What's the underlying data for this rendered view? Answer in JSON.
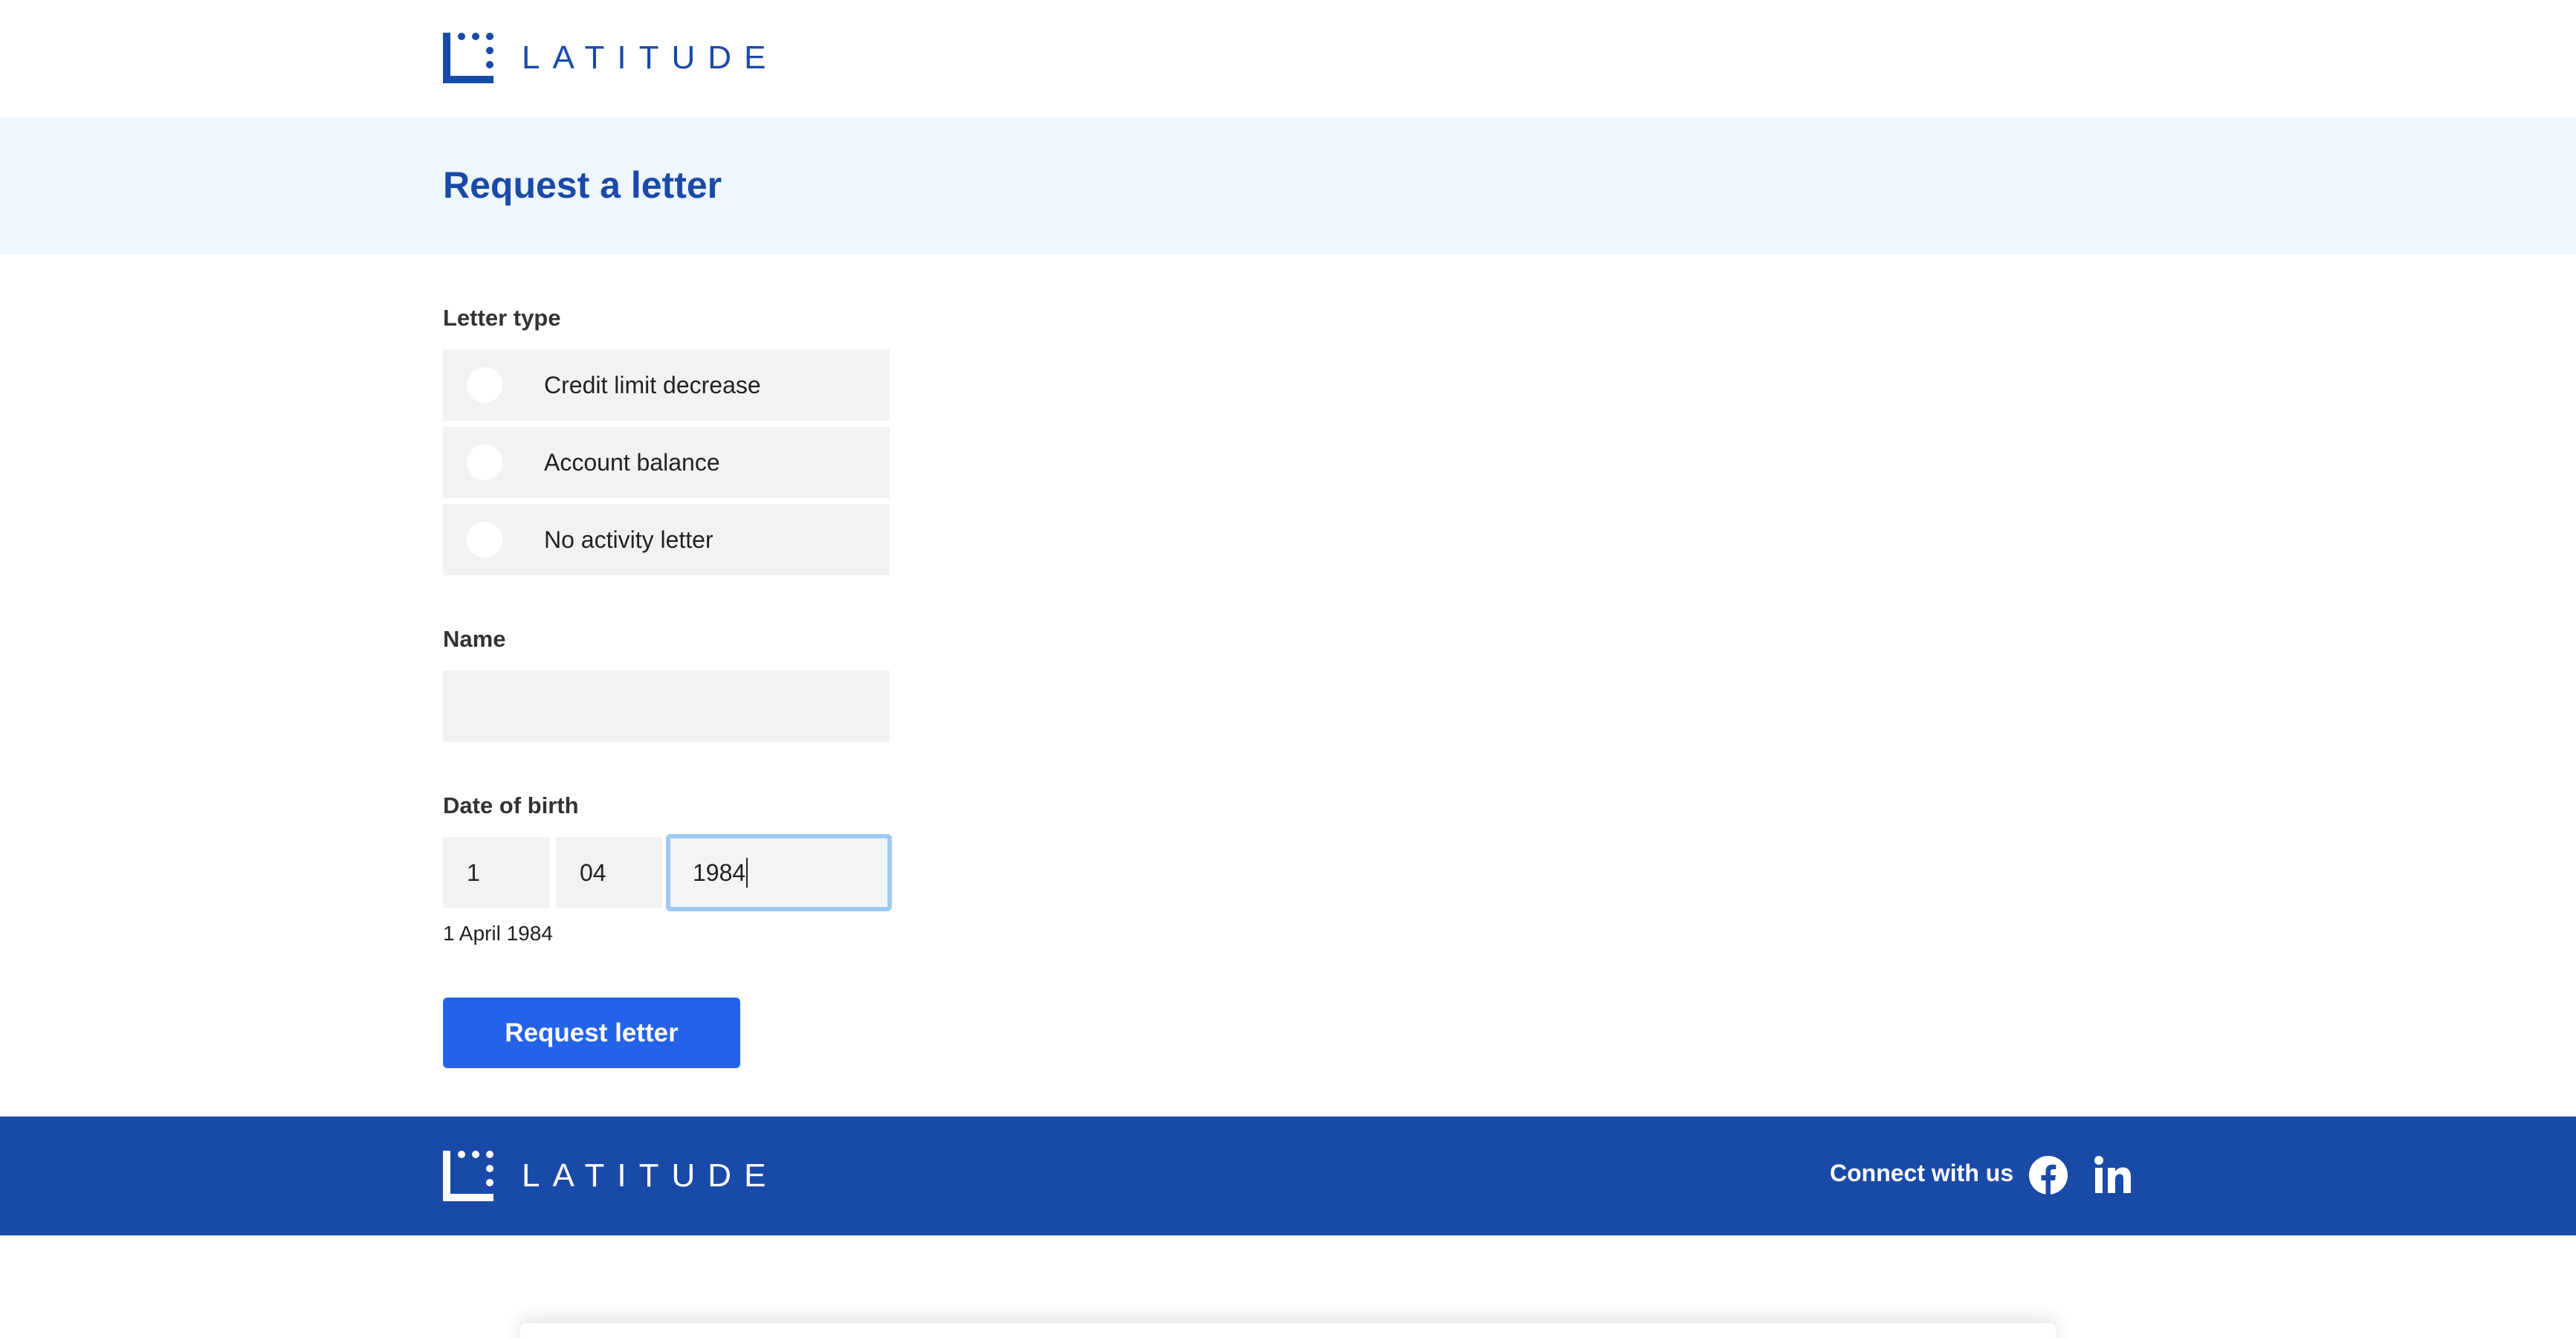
{
  "brand": {
    "name": "LATITUDE",
    "color": "#1a4aa8"
  },
  "page": {
    "title": "Request a letter"
  },
  "letter_type": {
    "label": "Letter type",
    "options": [
      {
        "label": "Credit limit decrease",
        "selected": false
      },
      {
        "label": "Account balance",
        "selected": false
      },
      {
        "label": "No activity letter",
        "selected": false
      }
    ]
  },
  "name_field": {
    "label": "Name",
    "value": ""
  },
  "dob": {
    "label": "Date of birth",
    "day": "1",
    "month": "04",
    "year": "1984",
    "hint": "1 April 1984"
  },
  "submit": {
    "label": "Request letter",
    "color": "#2463e9"
  },
  "footer": {
    "brand": "LATITUDE",
    "connect_label": "Connect with us",
    "social": [
      "facebook-icon",
      "linkedin-icon"
    ]
  }
}
